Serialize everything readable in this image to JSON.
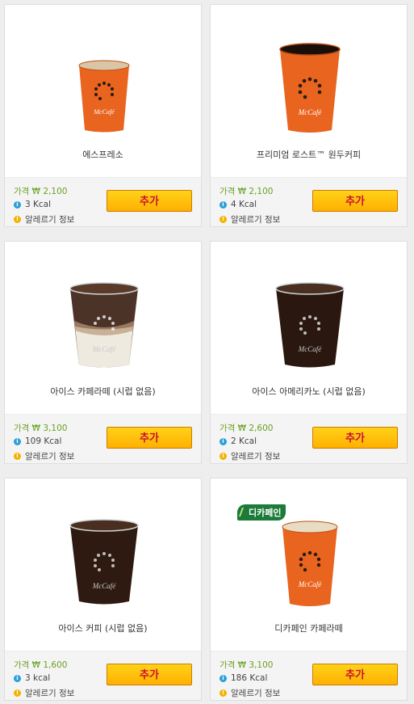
{
  "products": [
    {
      "name": "에스프레소",
      "price": "가격 ₩ 2,100",
      "kcal": "3 Kcal",
      "allergy": "알레르기 정보",
      "button": "추가",
      "image": "espresso-cup",
      "badge": ""
    },
    {
      "name": "프리미엄 로스트™ 원두커피",
      "price": "가격 ₩ 2,100",
      "kcal": "4 Kcal",
      "allergy": "알레르기 정보",
      "button": "추가",
      "image": "brewed-coffee-cup",
      "badge": ""
    },
    {
      "name": "아이스 카페라떼 (시럽 없음)",
      "price": "가격 ₩ 3,100",
      "kcal": "109 Kcal",
      "allergy": "알레르기 정보",
      "button": "추가",
      "image": "iced-latte-cup",
      "badge": ""
    },
    {
      "name": "아이스 아메리카노 (시럽 없음)",
      "price": "가격 ₩ 2,600",
      "kcal": "2 Kcal",
      "allergy": "알레르기 정보",
      "button": "추가",
      "image": "iced-americano-cup",
      "badge": ""
    },
    {
      "name": "아이스 커피 (시럽 없음)",
      "price": "가격 ₩ 1,600",
      "kcal": "3 kcal",
      "allergy": "알레르기 정보",
      "button": "추가",
      "image": "iced-coffee-cup",
      "badge": ""
    },
    {
      "name": "디카페인 카페라떼",
      "price": "가격 ₩ 3,100",
      "kcal": "186 Kcal",
      "allergy": "알레르기 정보",
      "button": "추가",
      "image": "decaf-latte-cup",
      "badge": "디카페인"
    }
  ],
  "icons": {
    "info": "info-icon",
    "allergy": "allergy-icon"
  },
  "colors": {
    "price": "#6aa121",
    "button_bg": "#ffc20e",
    "button_text": "#c8102e",
    "cup_orange": "#e8641f",
    "decaf_badge": "#1c7a3a"
  }
}
